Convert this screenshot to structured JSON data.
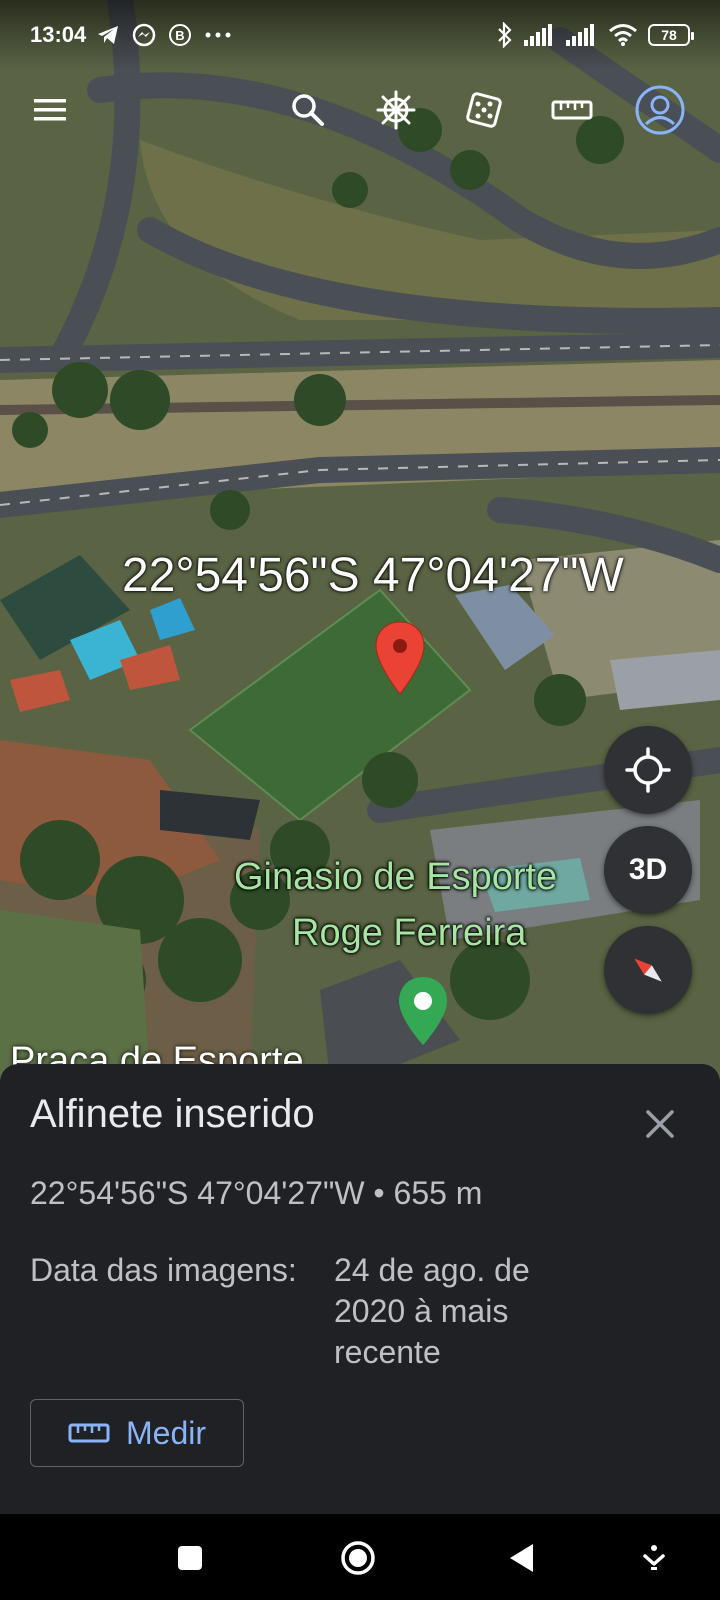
{
  "status_bar": {
    "time": "13:04",
    "left_icons": [
      "telegram-icon",
      "messenger-icon",
      "b-circle-icon",
      "more-dots-icon"
    ],
    "right_icons": [
      "bluetooth-icon",
      "signal-icon",
      "signal-icon",
      "wifi-icon"
    ],
    "battery": "78"
  },
  "toolbar": {
    "buttons": [
      "menu-icon",
      "search-icon",
      "voyager-wheel-icon",
      "dice-icon",
      "ruler-icon",
      "account-icon"
    ]
  },
  "map": {
    "coordinate_overlay": "22°54'56\"S 47°04'27\"W",
    "place_label_line1": "Ginasio de Esporte",
    "place_label_line2": "Roge Ferreira",
    "place_label_partial": "Praça de Esporte",
    "pin_color": "#ea4335",
    "poi_pin_color": "#34a853",
    "label_color": "#a6e6a2"
  },
  "fabs": {
    "location": "crosshair-icon",
    "three_d_label": "3D",
    "compass": "compass-icon"
  },
  "sheet": {
    "title": "Alfinete inserido",
    "coords": "22°54'56\"S 47°04'27\"W • 655 m",
    "date_label": "Data das imagens:",
    "date_value": "24 de ago. de 2020 à mais recente",
    "measure_label": "Medir"
  },
  "navbar": {
    "buttons": [
      "recents-icon",
      "home-icon",
      "back-icon",
      "keyboard-hide-icon"
    ]
  },
  "colors": {
    "sheet_bg": "#202124",
    "accent": "#8ab4f8",
    "fab_bg": "#303134"
  }
}
